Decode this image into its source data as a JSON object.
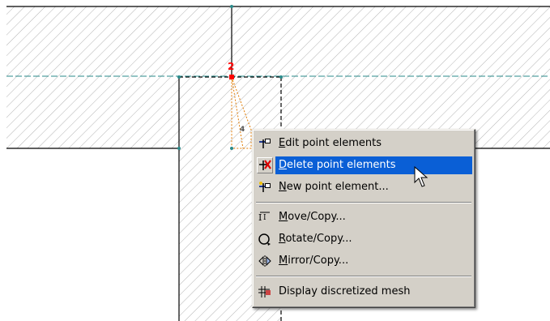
{
  "canvas": {
    "point_label": "2",
    "element_label": "4"
  },
  "context_menu": {
    "items": [
      {
        "label": "Edit point elements",
        "mnemonic": "E",
        "icon": "edit-point-elements-icon",
        "highlighted": false
      },
      {
        "label": "Delete point elements",
        "mnemonic": "D",
        "icon": "delete-point-elements-icon",
        "highlighted": true
      },
      {
        "label": "New point element...",
        "mnemonic": "N",
        "icon": "new-point-element-icon",
        "highlighted": false
      },
      {
        "label": "Move/Copy...",
        "mnemonic": "M",
        "icon": "move-copy-icon",
        "highlighted": false
      },
      {
        "label": "Rotate/Copy...",
        "mnemonic": "R",
        "icon": "rotate-copy-icon",
        "highlighted": false
      },
      {
        "label": "Mirror/Copy...",
        "mnemonic": "M",
        "icon": "mirror-copy-icon",
        "highlighted": false
      },
      {
        "label": "Display discretized mesh",
        "mnemonic": "",
        "icon": "display-mesh-icon",
        "highlighted": false
      }
    ]
  },
  "colors": {
    "highlight": "#0a5fd6",
    "menu_bg": "#d4d0c8",
    "hatch": "#b4b4b4",
    "dashed_line": "#2a8a8a",
    "node_marker": "#ff0000",
    "element_outline": "#e07a00"
  }
}
